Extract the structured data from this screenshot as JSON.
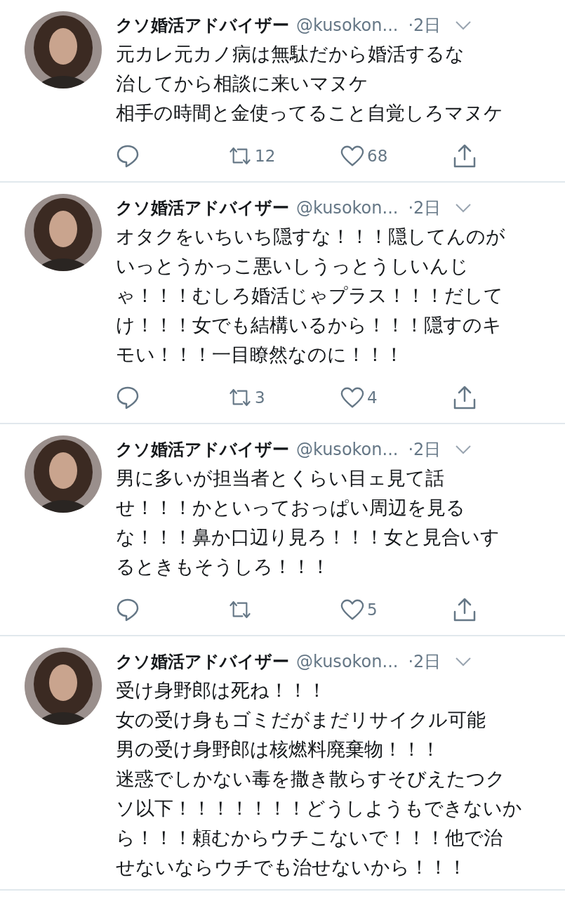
{
  "tweets": [
    {
      "name": "クソ婚活アドバイザー",
      "handle": "@kusokon...",
      "time": "·2日",
      "lines": [
        "元カレ元カノ病は無駄だから婚活するな",
        "治してから相談に来いマヌケ",
        "相手の時間と金使ってること自覚しろマヌケ"
      ],
      "actions": {
        "retweets": "12",
        "likes": "68"
      }
    },
    {
      "name": "クソ婚活アドバイザー",
      "handle": "@kusokon...",
      "time": "·2日",
      "lines": [
        "オタクをいちいち隠すな！！！隠してんのが",
        "いっとうかっこ悪いしうっとうしいんじ",
        "ゃ！！！むしろ婚活じゃプラス！！！だして",
        "け！！！女でも結構いるから！！！隠すのキ",
        "モい！！！一目瞭然なのに！！！"
      ],
      "actions": {
        "retweets": "3",
        "likes": "4"
      }
    },
    {
      "name": "クソ婚活アドバイザー",
      "handle": "@kusokon...",
      "time": "·2日",
      "lines": [
        "男に多いが担当者とくらい目ェ見て話",
        "せ！！！かといっておっぱい周辺を見る",
        "な！！！鼻か口辺り見ろ！！！女と見合いす",
        "るときもそうしろ！！！"
      ],
      "actions": {
        "likes": "5"
      }
    },
    {
      "name": "クソ婚活アドバイザー",
      "handle": "@kusokon...",
      "time": "·2日",
      "lines": [
        "受け身野郎は死ね！！！",
        "女の受け身もゴミだがまだリサイクル可能",
        "男の受け身野郎は核燃料廃棄物！！！",
        "迷惑でしかない毒を撒き散らすそびえたつク",
        "ソ以下！！！！！！！どうしようもできないか",
        "ら！！！頼むからウチこないで！！！他で治",
        "せないならウチでも治せないから！！！"
      ]
    }
  ]
}
